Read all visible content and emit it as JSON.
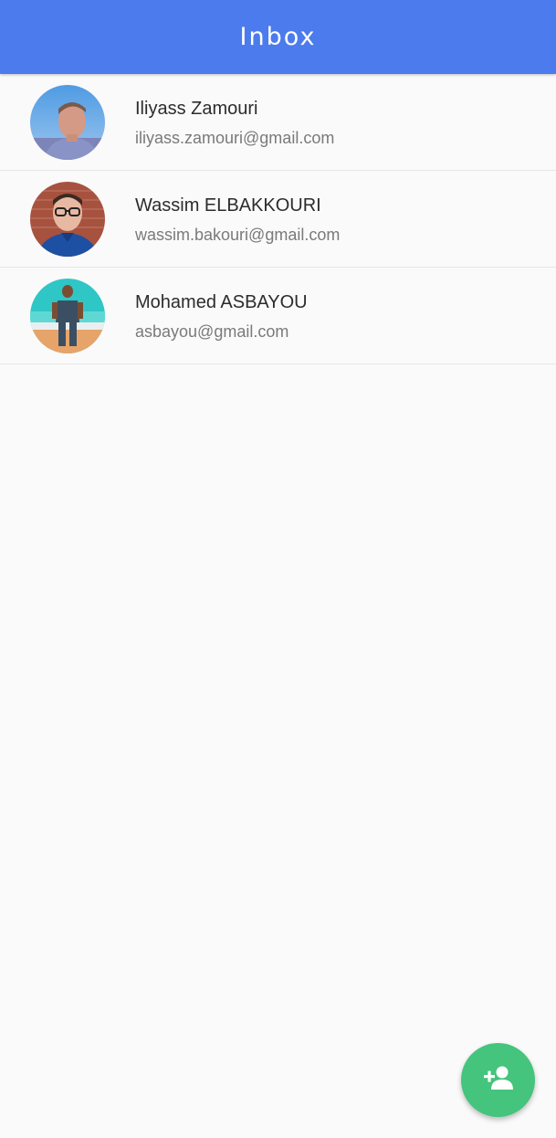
{
  "appbar": {
    "title": "Inbox",
    "color": "#4b7bec"
  },
  "contacts": [
    {
      "name": "Iliyass Zamouri",
      "email": "iliyass.zamouri@gmail.com"
    },
    {
      "name": "Wassim ELBAKKOURI",
      "email": "wassim.bakouri@gmail.com"
    },
    {
      "name": "Mohamed ASBAYOU",
      "email": "asbayou@gmail.com"
    }
  ],
  "fab": {
    "icon": "person-add-icon",
    "color": "#44c47c"
  }
}
